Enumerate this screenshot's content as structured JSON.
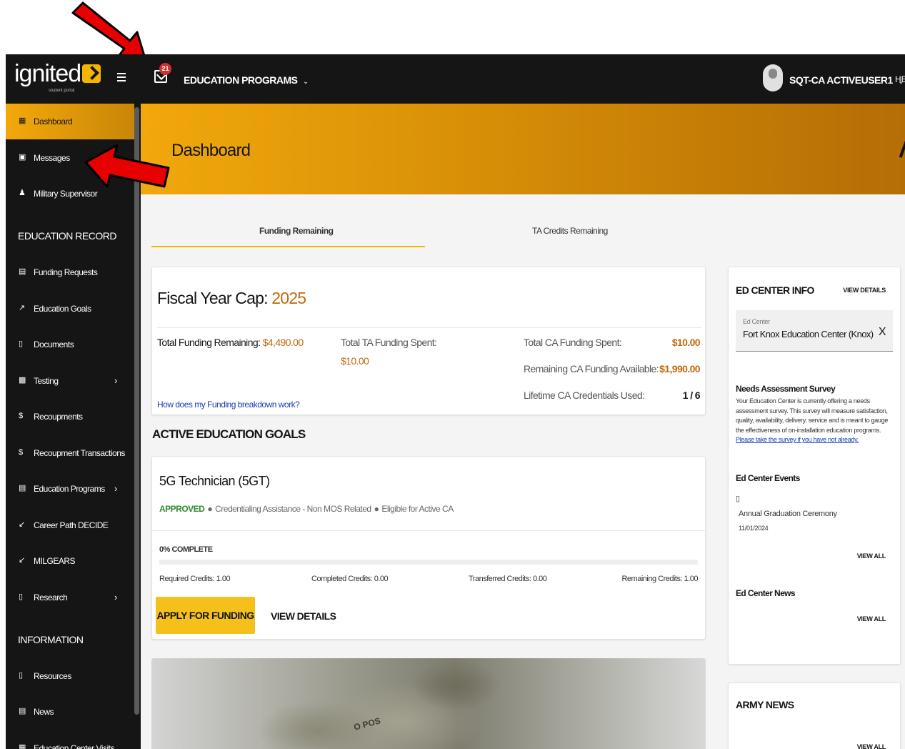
{
  "header": {
    "logo_text": "ignited",
    "logo_sub": "student portal",
    "notification_count": "21",
    "nav_title": "EDUCATION PROGRAMS",
    "user_name": "SQT-CA ACTIVEUSER1",
    "help_label": "HE"
  },
  "sidebar": {
    "items": [
      {
        "label": "Dashboard",
        "icon": "dashboard-icon"
      },
      {
        "label": "Messages",
        "icon": "message-icon"
      },
      {
        "label": "Military Supervisor",
        "icon": "people-icon"
      },
      {
        "label": "Funding Requests",
        "icon": "funding-icon"
      },
      {
        "label": "Education Goals",
        "icon": "trend-icon"
      },
      {
        "label": "Documents",
        "icon": "document-icon"
      },
      {
        "label": "Testing",
        "icon": "testing-icon"
      },
      {
        "label": "Recoupments",
        "icon": "dollar-icon"
      },
      {
        "label": "Recoupment Transactions",
        "icon": "dollar-icon"
      },
      {
        "label": "Education Programs",
        "icon": "programs-icon"
      },
      {
        "label": "Career Path DECIDE",
        "icon": "arrow-icon"
      },
      {
        "label": "MILGEARS",
        "icon": "arrow-icon"
      },
      {
        "label": "Research",
        "icon": "research-icon"
      },
      {
        "label": "Resources",
        "icon": "document-icon"
      },
      {
        "label": "News",
        "icon": "news-icon"
      },
      {
        "label": "Education Center Visits",
        "icon": "calendar-icon"
      }
    ],
    "sections": {
      "education_record": "EDUCATION RECORD",
      "information": "INFORMATION"
    }
  },
  "banner": {
    "title": "Dashboard"
  },
  "tabs": [
    "Funding Remaining",
    "TA Credits Remaining"
  ],
  "fiscal": {
    "title_prefix": "Fiscal Year Cap:",
    "year": "2025",
    "total_remaining_label": "Total Funding Remaining:",
    "total_remaining_value": "$4,490.00",
    "ta_spent_label": "Total TA Funding Spent:",
    "ta_spent_value": "$10.00",
    "ca_spent_label": "Total CA Funding Spent:",
    "ca_spent_value": "$10.00",
    "ca_available_label": "Remaining CA Funding Available:",
    "ca_available_value": "$1,990.00",
    "ca_credentials_label": "Lifetime CA Credentials Used:",
    "ca_credentials_value": "1 / 6",
    "breakdown_link": "How does my Funding breakdown work?"
  },
  "goals": {
    "section_title": "ACTIVE EDUCATION GOALS",
    "goal_title": "5G Technician (5GT)",
    "status": "APPROVED",
    "meta1": "Credentialing Assistance - Non MOS Related",
    "meta2": "Eligible for Active CA",
    "complete": "0% COMPLETE",
    "progress_percent": 0,
    "required": "Required Credits: 1.00",
    "completed": "Completed Credits: 0.00",
    "transferred": "Transferred Credits: 0.00",
    "remaining": "Remaining Credits: 1.00",
    "apply_label": "APPLY FOR FUNDING",
    "view_label": "VIEW DETAILS"
  },
  "photo_text": "O POS",
  "ed_center": {
    "title": "ED CENTER INFO",
    "view_details": "VIEW DETAILS",
    "field_label": "Ed Center",
    "field_value": "Fort Knox Education Center (Knox)",
    "clear": "X",
    "survey_title": "Needs Assessment Survey",
    "survey_text": "Your Education Center is currently offering a needs assessment survey. This survey will measure satisfaction, quality, availability, delivery, service and is meant to gauge the effectiveness of on-installation education programs.",
    "survey_link": "Please take the survey if you have not already.",
    "events_title": "Ed Center Events",
    "event_name": "Annual Graduation Ceremony",
    "event_date": "11/01/2024",
    "view_all": "VIEW ALL",
    "news_title": "Ed Center News"
  },
  "army_news": {
    "title": "ARMY NEWS",
    "view_all": "VIEW ALL"
  },
  "colors": {
    "accent": "#f3a90b",
    "dark": "#151515",
    "orange_text": "#c06a0a",
    "approved": "#2e8b2e",
    "arrow": "#e60000"
  }
}
